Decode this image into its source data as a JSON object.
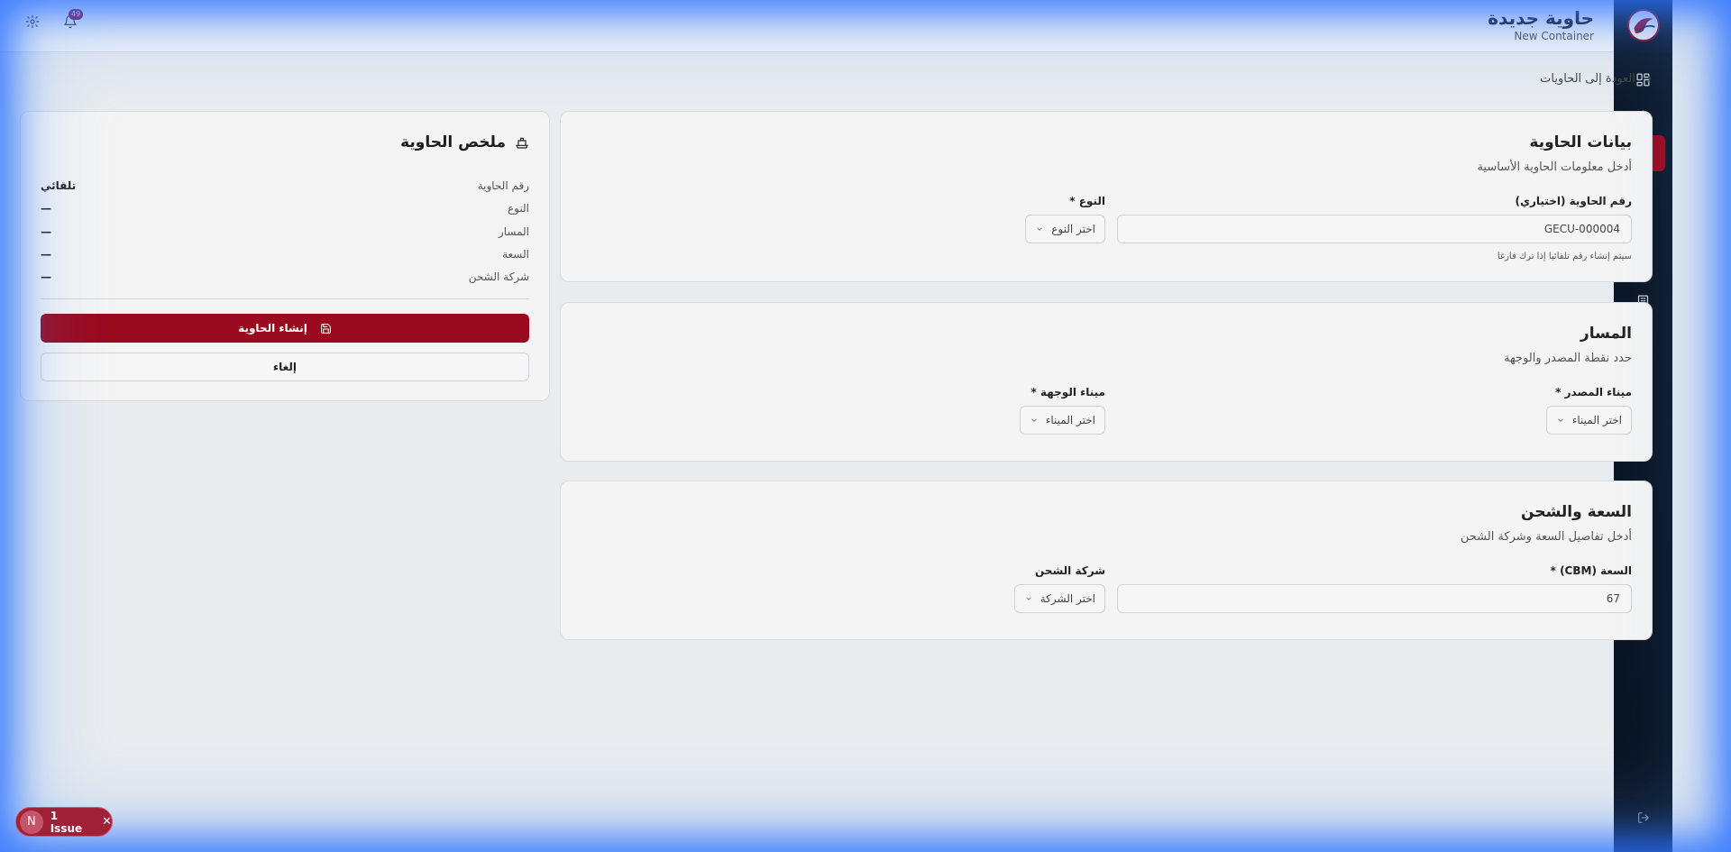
{
  "header": {
    "title_ar": "حاوية جديدة",
    "title_en": "New Container",
    "notification_count": "49"
  },
  "back_link": "العودة إلى الحاويات",
  "sidebar": {
    "items": [
      {
        "icon": "dashboard-icon"
      },
      {
        "icon": "box-icon"
      },
      {
        "icon": "ship-icon",
        "active": true
      },
      {
        "icon": "users-icon"
      },
      {
        "icon": "document-icon"
      },
      {
        "icon": "anchor-icon"
      },
      {
        "icon": "building-icon"
      },
      {
        "icon": "dollar-icon"
      },
      {
        "icon": "activity-icon"
      },
      {
        "icon": "chart-icon"
      },
      {
        "icon": "gear-icon"
      }
    ]
  },
  "container_info": {
    "title": "بيانات الحاوية",
    "subtitle": "أدخل معلومات الحاوية الأساسية",
    "number_label": "رقم الحاوية (اختياري)",
    "number_value": "GECU-000004",
    "number_hint": "سيتم إنشاء رقم تلقائيا إذا ترك فارغا",
    "type_label": "النوع *",
    "type_placeholder": "اختر النوع"
  },
  "route": {
    "title": "المسار",
    "subtitle": "حدد نقطة المصدر والوجهة",
    "origin_label": "ميناء المصدر *",
    "origin_placeholder": "اختر الميناء",
    "dest_label": "ميناء الوجهة *",
    "dest_placeholder": "اختر الميناء"
  },
  "capacity": {
    "title": "السعة والشحن",
    "subtitle": "أدخل تفاصيل السعة وشركة الشحن",
    "capacity_label": "السعة (CBM) *",
    "capacity_value": "67",
    "company_label": "شركة الشحن",
    "company_placeholder": "اختر الشركة"
  },
  "summary": {
    "title": "ملخص الحاوية",
    "rows": [
      {
        "key": "رقم الحاوية",
        "value": "تلقائي"
      },
      {
        "key": "النوع",
        "value": "—"
      },
      {
        "key": "المسار",
        "value": "—"
      },
      {
        "key": "السعة",
        "value": "—"
      },
      {
        "key": "شركة الشحن",
        "value": "—"
      }
    ],
    "create_label": "إنشاء الحاوية",
    "cancel_label": "إلغاء"
  },
  "issue": {
    "letter": "N",
    "label": "1 Issue"
  },
  "colors": {
    "accent": "#9a0a1e",
    "sidebar_bg": "#0d1a2b",
    "page_bg": "#e9ecef"
  }
}
